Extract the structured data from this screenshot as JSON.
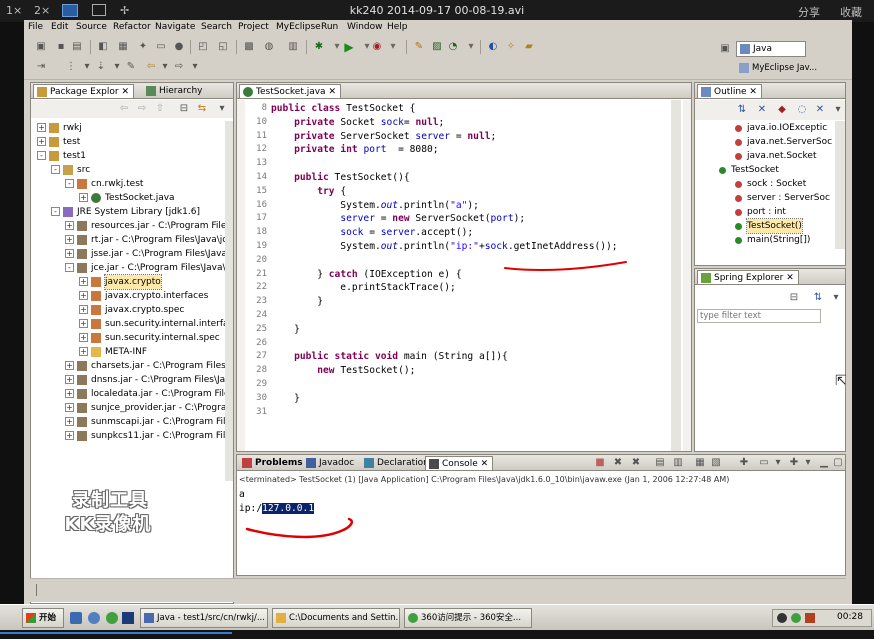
{
  "player": {
    "speed1": "1×",
    "speed2": "2×",
    "title": "kk240 2014-09-17 00-08-19.avi",
    "share": "分享",
    "collapse": "收藏"
  },
  "menu": [
    "File",
    "Edit",
    "Source",
    "Refactor",
    "Navigate",
    "Search",
    "Project",
    "MyEclipse",
    "Run",
    "Window",
    "Help"
  ],
  "perspectives": {
    "java": "Java",
    "myeclipse": "MyEclipse Jav..."
  },
  "package_explorer": {
    "tabs": [
      "Package Explor",
      "Hierarchy"
    ],
    "rows": [
      {
        "label": "rwkj",
        "indent": 0,
        "twisty": "+",
        "icon": "project"
      },
      {
        "label": "test",
        "indent": 0,
        "twisty": "+",
        "icon": "project"
      },
      {
        "label": "test1",
        "indent": 0,
        "twisty": "-",
        "icon": "project"
      },
      {
        "label": "src",
        "indent": 1,
        "twisty": "-",
        "icon": "src-folder"
      },
      {
        "label": "cn.rwkj.test",
        "indent": 2,
        "twisty": "-",
        "icon": "package"
      },
      {
        "label": "TestSocket.java",
        "indent": 3,
        "twisty": "+",
        "icon": "java-file"
      },
      {
        "label": "JRE System Library [jdk1.6]",
        "indent": 1,
        "twisty": "-",
        "icon": "library"
      },
      {
        "label": "resources.jar - C:\\Program Files\\Ja",
        "indent": 2,
        "twisty": "+",
        "icon": "jar"
      },
      {
        "label": "rt.jar - C:\\Program Files\\Java\\jdk1",
        "indent": 2,
        "twisty": "+",
        "icon": "jar"
      },
      {
        "label": "jsse.jar - C:\\Program Files\\Java\\jd",
        "indent": 2,
        "twisty": "+",
        "icon": "jar"
      },
      {
        "label": "jce.jar - C:\\Program Files\\Java\\jdk",
        "indent": 2,
        "twisty": "-",
        "icon": "jar"
      },
      {
        "label": "javax.crypto",
        "indent": 3,
        "twisty": "+",
        "icon": "package",
        "selected": true
      },
      {
        "label": "javax.crypto.interfaces",
        "indent": 3,
        "twisty": "+",
        "icon": "package"
      },
      {
        "label": "javax.crypto.spec",
        "indent": 3,
        "twisty": "+",
        "icon": "package"
      },
      {
        "label": "sun.security.internal.interface",
        "indent": 3,
        "twisty": "+",
        "icon": "package"
      },
      {
        "label": "sun.security.internal.spec",
        "indent": 3,
        "twisty": "+",
        "icon": "package"
      },
      {
        "label": "META-INF",
        "indent": 3,
        "twisty": "+",
        "icon": "folder"
      },
      {
        "label": "charsets.jar - C:\\Program Files\\Jav",
        "indent": 2,
        "twisty": "+",
        "icon": "jar"
      },
      {
        "label": "dnsns.jar - C:\\Program Files\\Java\\",
        "indent": 2,
        "twisty": "+",
        "icon": "jar"
      },
      {
        "label": "localedata.jar - C:\\Program Files\\J",
        "indent": 2,
        "twisty": "+",
        "icon": "jar"
      },
      {
        "label": "sunjce_provider.jar - C:\\Program F",
        "indent": 2,
        "twisty": "+",
        "icon": "jar"
      },
      {
        "label": "sunmscapi.jar - C:\\Program Files\\J",
        "indent": 2,
        "twisty": "+",
        "icon": "jar"
      },
      {
        "label": "sunpkcs11.jar - C:\\Program Files\\J",
        "indent": 2,
        "twisty": "+",
        "icon": "jar"
      }
    ]
  },
  "editor": {
    "tab": "TestSocket.java",
    "lines": [
      {
        "n": "8",
        "html": "<span class=\"kw\">public class</span> TestSocket {"
      },
      {
        "n": "10",
        "html": "    <span class=\"kw\">private</span> Socket <span class=\"fld\">sock</span>= <span class=\"kw\">null</span>;"
      },
      {
        "n": "11",
        "html": "    <span class=\"kw\">private</span> ServerSocket <span class=\"fld\">server</span> = <span class=\"kw\">null</span>;"
      },
      {
        "n": "12",
        "html": "    <span class=\"kw\">private int</span> <span class=\"fld\">port</span>  = 8080;"
      },
      {
        "n": "13",
        "html": ""
      },
      {
        "n": "14",
        "html": "    <span class=\"kw\">public</span> TestSocket(){"
      },
      {
        "n": "15",
        "html": "        <span class=\"kw\">try</span> {"
      },
      {
        "n": "16",
        "html": "            System.<span class=\"fi\">out</span>.println(<span class=\"str\">\"a\"</span>);"
      },
      {
        "n": "17",
        "html": "            <span class=\"fld\">server</span> = <span class=\"kw\">new</span> ServerSocket(<span class=\"fld\">port</span>);"
      },
      {
        "n": "18",
        "html": "            <span class=\"fld\">sock</span> = <span class=\"fld\">server</span>.accept();"
      },
      {
        "n": "19",
        "html": "            System.<span class=\"fi\">out</span>.println(<span class=\"str\">\"ip:\"</span>+<span class=\"fld\">sock</span>.getInetAddress());"
      },
      {
        "n": "20",
        "html": ""
      },
      {
        "n": "21",
        "html": "        } <span class=\"kw\">catch</span> (IOException e) {"
      },
      {
        "n": "22",
        "html": "            e.printStackTrace();"
      },
      {
        "n": "23",
        "html": "        }"
      },
      {
        "n": "24",
        "html": ""
      },
      {
        "n": "25",
        "html": "    }"
      },
      {
        "n": "26",
        "html": ""
      },
      {
        "n": "27",
        "html": "    <span class=\"kw\">public static void</span> main (String a[]){"
      },
      {
        "n": "28",
        "html": "        <span class=\"kw\">new</span> TestSocket();"
      },
      {
        "n": "29",
        "html": ""
      },
      {
        "n": "30",
        "html": "    }"
      },
      {
        "n": "31",
        "html": ""
      }
    ]
  },
  "outline": {
    "tab": "Outline",
    "rows": [
      {
        "label": "java.io.IOExceptic",
        "indent": 2
      },
      {
        "label": "java.net.ServerSoc",
        "indent": 2
      },
      {
        "label": "java.net.Socket",
        "indent": 2
      },
      {
        "label": "TestSocket",
        "indent": 1
      },
      {
        "label": "sock : Socket",
        "indent": 2
      },
      {
        "label": "server : ServerSoc",
        "indent": 2
      },
      {
        "label": "port : int",
        "indent": 2
      },
      {
        "label": "TestSocket()",
        "indent": 2,
        "selected": true
      },
      {
        "label": "main(String[])",
        "indent": 2
      }
    ]
  },
  "spring": {
    "tab": "Spring Explorer",
    "filter_placeholder": "type filter text"
  },
  "console": {
    "tabs": [
      "Problems",
      "Javadoc",
      "Declaration",
      "Console"
    ],
    "header": "<terminated> TestSocket (1) [Java Application] C:\\Program Files\\Java\\jdk1.6.0_10\\bin\\javaw.exe (Jan 1, 2006 12:27:48 AM)",
    "line1": "a",
    "line2_prefix": "ip:/",
    "line2_selected": "127.0.0.1"
  },
  "watermark": {
    "line1": "录制工具",
    "line2": "KK录像机"
  },
  "taskbar": {
    "start": "开始",
    "tasks": [
      "Java - test1/src/cn/rwkj/...",
      "C:\\Documents and Settin...",
      "360访问提示 - 360安全..."
    ],
    "clock": "00:28"
  },
  "colors": {
    "accent_red": "#e00000",
    "selection": "#0a246a"
  }
}
